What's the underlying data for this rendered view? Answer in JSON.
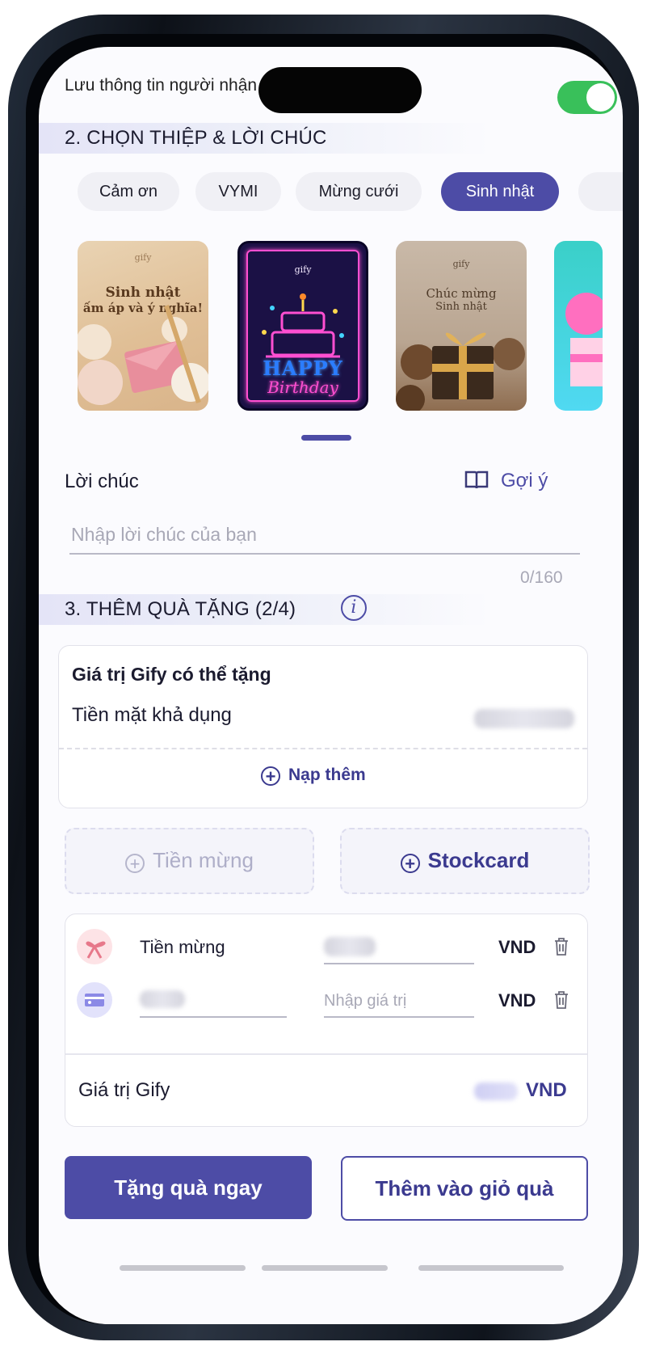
{
  "top_bar": {
    "save_info_label": "Lưu thông tin người nhận",
    "save_info_enabled": true
  },
  "section2": {
    "title": "2. CHỌN THIỆP & LỜI CHÚC",
    "chips": [
      {
        "label": "Cảm ơn",
        "active": false
      },
      {
        "label": "VYMI",
        "active": false
      },
      {
        "label": "Mừng cưới",
        "active": false
      },
      {
        "label": "Sinh nhật",
        "active": true
      }
    ],
    "cards": [
      {
        "brand": "gify",
        "text_line1": "Sinh nhật",
        "text_line2": "ấm áp và ý nghĩa!"
      },
      {
        "brand": "gify",
        "text_line1": "HAPPY",
        "text_line2": "Birthday"
      },
      {
        "brand": "gify",
        "text_line1": "Chúc mừng",
        "text_line2": "Sinh nhật"
      }
    ],
    "wish_label": "Lời chúc",
    "suggest_label": "Gợi ý",
    "wish_placeholder": "Nhập lời chúc của bạn",
    "wish_counter": "0/160"
  },
  "section3": {
    "title": "3. THÊM QUÀ TẶNG (2/4)",
    "info_icon": "i",
    "gify_value_title": "Giá trị Gify có thể tặng",
    "cash_label": "Tiền mặt khả dụng",
    "topup_label": "Nạp thêm",
    "options": [
      {
        "label": "Tiền mừng",
        "enabled": false
      },
      {
        "label": "Stockcard",
        "enabled": true
      }
    ],
    "gift_rows": [
      {
        "icon": "gift-bow-icon",
        "name": "Tiền mừng",
        "value_placeholder": "",
        "currency": "VND"
      },
      {
        "icon": "stock-card-icon",
        "name": "",
        "value_placeholder": "Nhập giá trị",
        "currency": "VND"
      }
    ],
    "total_label": "Giá trị Gify",
    "total_currency": "VND"
  },
  "actions": {
    "primary": "Tặng quà ngay",
    "secondary": "Thêm vào giỏ quà"
  },
  "colors": {
    "accent": "#4d4ca6",
    "toggle_on": "#39c05a",
    "section_bg": "#e4e4f7"
  }
}
